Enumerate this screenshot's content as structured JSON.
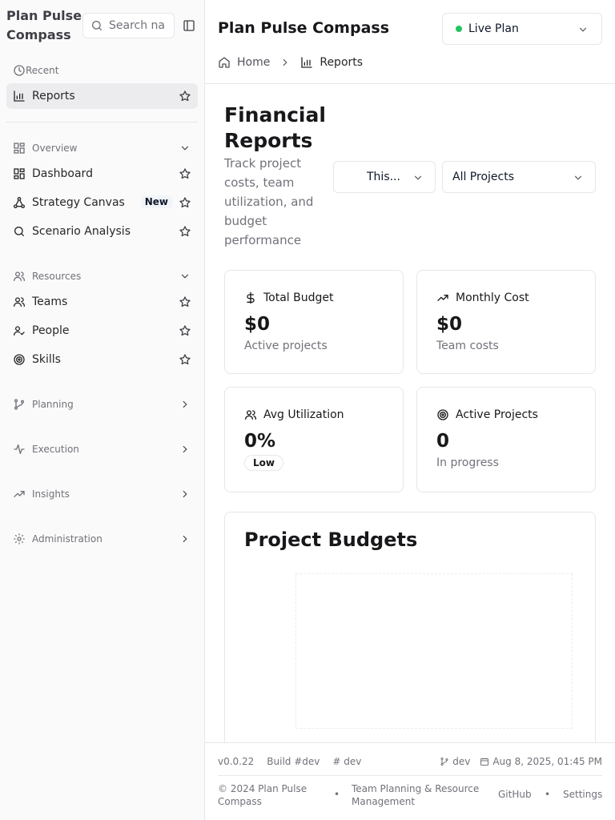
{
  "sidebar": {
    "brand": "Plan Pulse Compass",
    "search_placeholder": "Search na",
    "recent_label": "Recent",
    "recent_items": [
      {
        "label": "Reports"
      }
    ],
    "groups": {
      "overview": {
        "label": "Overview",
        "items": [
          {
            "label": "Dashboard"
          },
          {
            "label": "Strategy Canvas",
            "badge": "New"
          },
          {
            "label": "Scenario Analysis"
          }
        ]
      },
      "resources": {
        "label": "Resources",
        "items": [
          {
            "label": "Teams"
          },
          {
            "label": "People"
          },
          {
            "label": "Skills"
          }
        ]
      },
      "planning": {
        "label": "Planning"
      },
      "execution": {
        "label": "Execution"
      },
      "insights": {
        "label": "Insights"
      },
      "administration": {
        "label": "Administration"
      }
    }
  },
  "header": {
    "title": "Plan Pulse Compass",
    "plan_selector": "Live Plan",
    "plan_status_color": "#22c55e",
    "breadcrumb": {
      "home": "Home",
      "current": "Reports"
    }
  },
  "page": {
    "title": "Financial Reports",
    "subtitle": "Track project costs, team utilization, and budget performance",
    "period_filter": "This...",
    "project_filter": "All Projects"
  },
  "stats": [
    {
      "label": "Total Budget",
      "value": "$0",
      "sub": "Active projects",
      "icon": "dollar-icon"
    },
    {
      "label": "Monthly Cost",
      "value": "$0",
      "sub": "Team costs",
      "icon": "trending-up-icon"
    },
    {
      "label": "Avg Utilization",
      "value": "0%",
      "badge": "Low",
      "icon": "users-icon"
    },
    {
      "label": "Active Projects",
      "value": "0",
      "sub": "In progress",
      "icon": "target-icon"
    }
  ],
  "budgets_card": {
    "title": "Project Budgets"
  },
  "footer": {
    "version": "v0.0.22",
    "build": "Build #dev",
    "channel": "# dev",
    "branch": "dev",
    "date": "Aug 8, 2025, 01:45 PM",
    "copyright": "© 2024 Plan Pulse Compass",
    "bullet": "•",
    "tagline": "Team Planning & Resource Management",
    "github": "GitHub",
    "settings": "Settings"
  }
}
